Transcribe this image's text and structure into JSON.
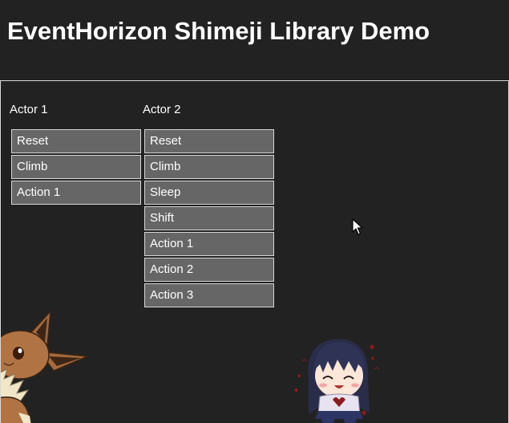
{
  "page": {
    "title": "EventHorizon Shimeji Library Demo"
  },
  "actors": [
    {
      "title": "Actor 1",
      "buttons": [
        "Reset",
        "Climb",
        "Action 1"
      ]
    },
    {
      "title": "Actor 2",
      "buttons": [
        "Reset",
        "Climb",
        "Sleep",
        "Shift",
        "Action 1",
        "Action 2",
        "Action 3"
      ]
    }
  ],
  "icons": {
    "cursor": "mouse-pointer-icon",
    "mascot_1": "eevee-shimeji-icon",
    "mascot_2": "chibi-girl-shimeji-icon"
  },
  "colors": {
    "background": "#222222",
    "button_bg": "#666666",
    "button_border": "#d6d6d6",
    "text": "#ffffff"
  }
}
